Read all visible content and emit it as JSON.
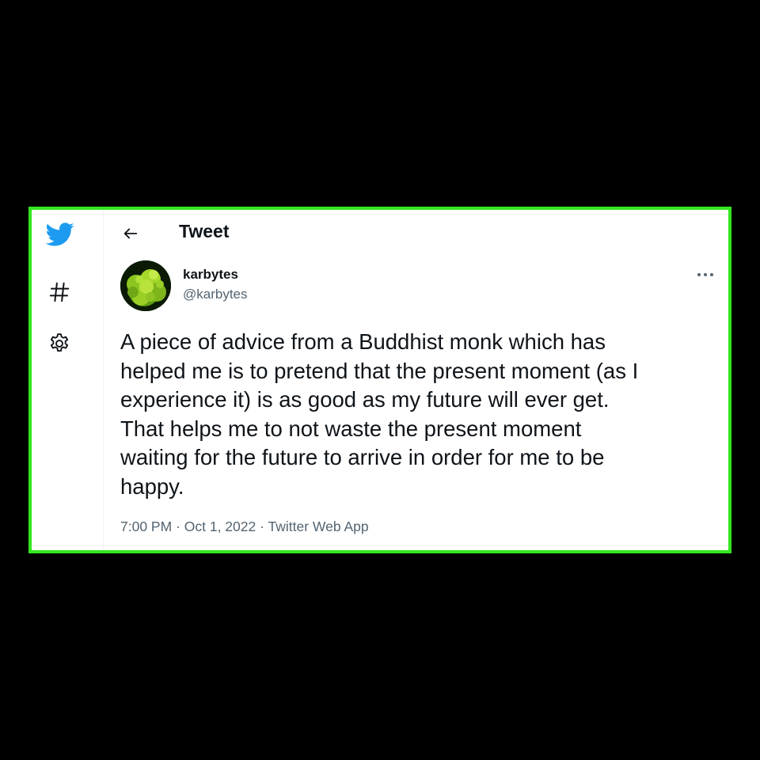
{
  "colors": {
    "frame_border": "#33e61f",
    "twitter_blue": "#1d9bf0",
    "text_primary": "#0f1419",
    "text_secondary": "#536471"
  },
  "sidebar": {
    "icons": [
      "twitter-bird-icon",
      "hashtag-icon",
      "gear-icon"
    ]
  },
  "header": {
    "title": "Tweet",
    "back_icon": "arrow-left-icon"
  },
  "tweet": {
    "display_name": "karbytes",
    "handle": "@karbytes",
    "more_icon": "more-horizontal-icon",
    "lines": [
      "A piece of advice from a Buddhist monk which has",
      "helped me is to pretend that the present moment (as I",
      "experience it) is as good as my future will ever get.",
      "That helps me to not waste the present moment",
      "waiting for the future to arrive in order for me to be",
      "happy."
    ],
    "time": "7:00 PM",
    "separator": "·",
    "date": "Oct 1, 2022",
    "source": "Twitter Web App"
  }
}
